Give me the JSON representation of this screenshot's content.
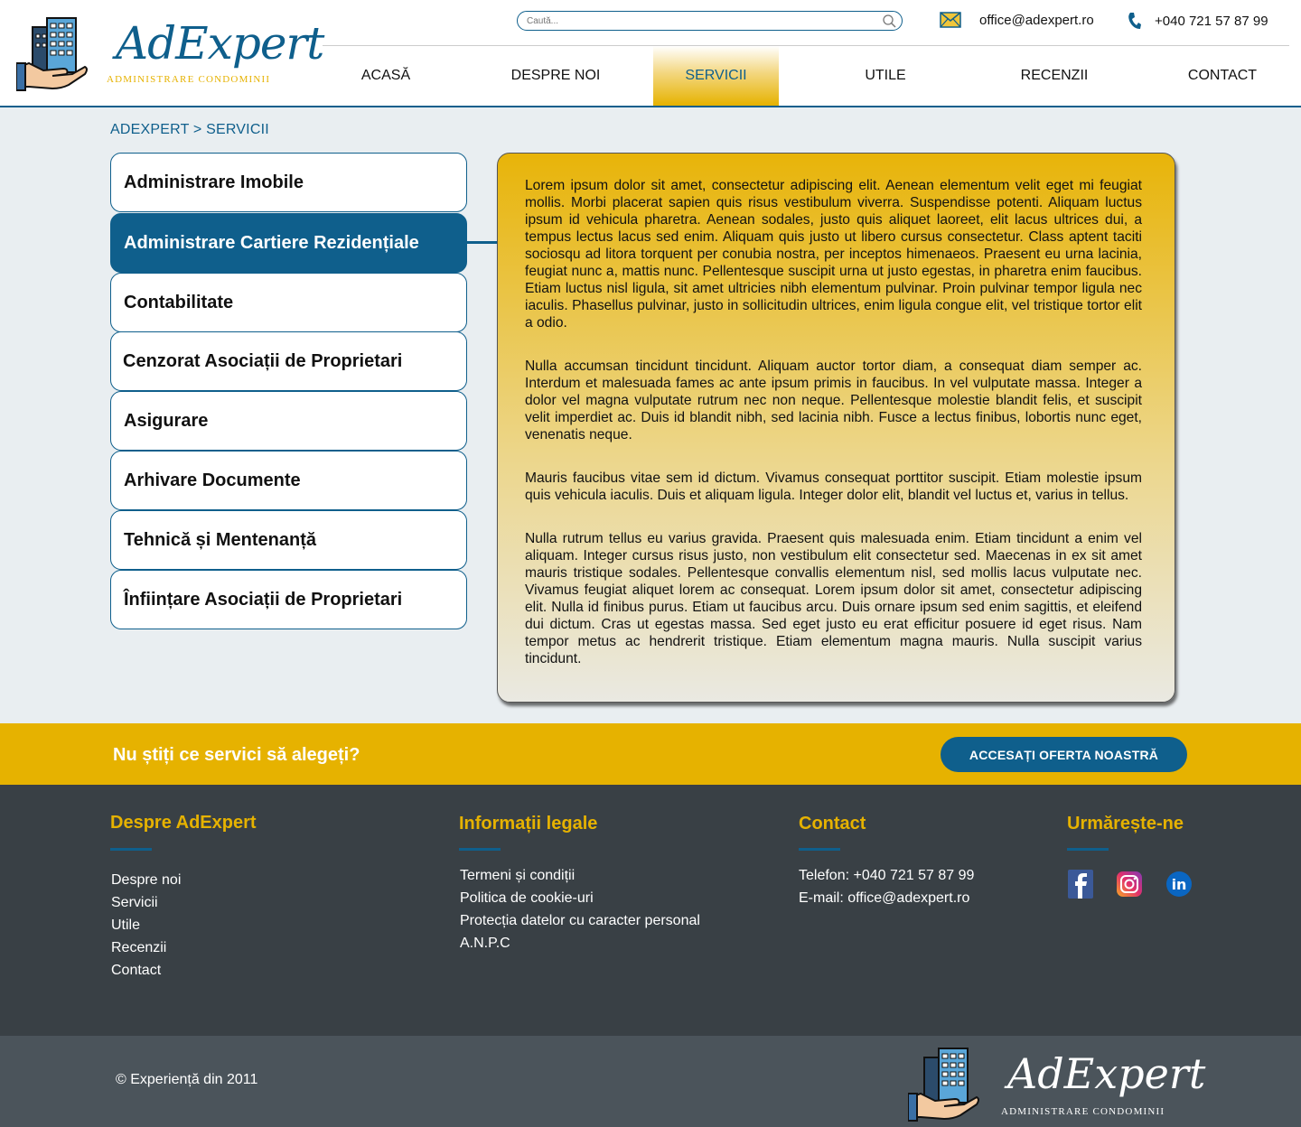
{
  "header": {
    "logo_text": "AdExpert",
    "logo_subtitle": "ADMINISTRARE CONDOMINII",
    "search_placeholder": "Caută...",
    "email": "office@adexpert.ro",
    "phone": "+040 721 57 87 99",
    "nav": [
      {
        "label": "ACASĂ",
        "active": false
      },
      {
        "label": "DESPRE NOI",
        "active": false
      },
      {
        "label": "SERVICII",
        "active": true
      },
      {
        "label": "UTILE",
        "active": false
      },
      {
        "label": "RECENZII",
        "active": false
      },
      {
        "label": "CONTACT",
        "active": false
      }
    ]
  },
  "breadcrumb": "ADEXPERT > SERVICII",
  "services": [
    {
      "label": "Administrare Imobile",
      "active": false
    },
    {
      "label": "Administrare Cartiere Rezidențiale",
      "active": true
    },
    {
      "label": "Contabilitate",
      "active": false
    },
    {
      "label": "Cenzorat Asociații de Proprietari",
      "active": false
    },
    {
      "label": "Asigurare",
      "active": false
    },
    {
      "label": "Arhivare Documente",
      "active": false
    },
    {
      "label": "Tehnică și Mentenanță",
      "active": false
    },
    {
      "label": "Înființare Asociații de Proprietari",
      "active": false
    }
  ],
  "content": {
    "paragraphs": [
      "Lorem ipsum dolor sit amet, consectetur adipiscing elit. Aenean elementum velit eget mi feugiat mollis. Morbi placerat sapien quis risus vestibulum viverra. Suspendisse potenti. Aliquam luctus ipsum id vehicula pharetra. Aenean sodales, justo quis aliquet laoreet, elit lacus ultrices dui, a tempus lectus lacus sed enim. Aliquam quis justo ut libero cursus consectetur. Class aptent taciti sociosqu ad litora torquent per conubia nostra, per inceptos himenaeos. Praesent eu urna lacinia, feugiat nunc a, mattis nunc. Pellentesque suscipit urna ut justo egestas, in pharetra enim faucibus. Etiam luctus nisl ligula, sit amet ultricies nibh elementum pulvinar. Proin pulvinar tempor ligula nec iaculis. Phasellus pulvinar, justo in sollicitudin ultrices, enim ligula congue elit, vel tristique tortor elit a odio.",
      "Nulla accumsan tincidunt tincidunt. Aliquam auctor tortor diam, a consequat diam semper ac. Interdum et malesuada fames ac ante ipsum primis in faucibus. In vel vulputate massa. Integer a dolor vel magna vulputate rutrum nec non neque. Pellentesque molestie blandit felis, et suscipit velit imperdiet ac. Duis id blandit nibh, sed lacinia nibh. Fusce a lectus finibus, lobortis nunc eget, venenatis neque.",
      "Mauris faucibus vitae sem id dictum. Vivamus consequat porttitor suscipit. Etiam molestie ipsum quis vehicula iaculis. Duis et aliquam ligula. Integer dolor elit, blandit vel luctus et, varius in tellus.",
      "Nulla rutrum tellus eu varius gravida. Praesent quis malesuada enim. Etiam tincidunt a enim vel aliquam. Integer cursus risus justo, non vestibulum elit consectetur sed. Maecenas in ex sit amet mauris tristique sodales. Pellentesque convallis elementum nisl, sed mollis lacus vulputate nec. Vivamus feugiat aliquet lorem ac consequat. Lorem ipsum dolor sit amet, consectetur adipiscing elit. Nulla id finibus purus. Etiam ut faucibus arcu. Duis ornare ipsum sed enim sagittis, et eleifend dui dictum. Cras ut egestas massa. Sed eget justo eu erat efficitur posuere id eget risus. Nam tempor metus ac hendrerit tristique. Etiam elementum magna mauris. Nulla suscipit varius tincidunt."
    ]
  },
  "cta": {
    "text": "Nu știți ce servici să alegeți?",
    "button": "ACCESAȚI OFERTA NOASTRĂ"
  },
  "footer": {
    "about": {
      "title": "Despre AdExpert",
      "links": [
        "Despre noi",
        "Servicii",
        "Utile",
        "Recenzii",
        "Contact"
      ]
    },
    "legal": {
      "title": "Informații legale",
      "links": [
        "Termeni și condiții",
        "Politica de cookie-uri",
        "Protecția datelor cu caracter personal",
        "A.N.P.C"
      ]
    },
    "contact": {
      "title": "Contact",
      "lines": [
        "Telefon: +040 721 57 87 99",
        "E-mail: office@adexpert.ro"
      ]
    },
    "follow": {
      "title": "Urmărește-ne",
      "icons": [
        "facebook-icon",
        "instagram-icon",
        "linkedin-icon"
      ]
    },
    "copyright": "© Experiență din 2011",
    "logo_text": "AdExpert",
    "logo_subtitle": "ADMINISTRARE CONDOMINII"
  },
  "colors": {
    "brand_blue": "#0f5f8c",
    "brand_yellow": "#e6b200",
    "footer_dark": "#394045",
    "footer_bottom": "#4b545b",
    "page_bg": "#e9eef1"
  }
}
